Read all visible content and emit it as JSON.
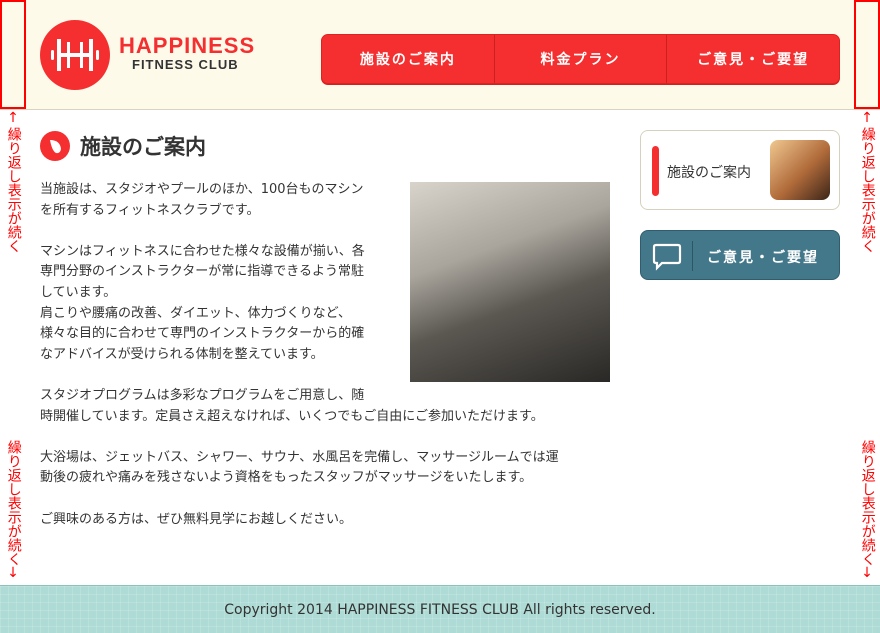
{
  "header": {
    "logo_line1": "HAPPINESS",
    "logo_line2": "FITNESS CLUB",
    "nav": [
      {
        "label": "施設のご案内"
      },
      {
        "label": "料金プラン"
      },
      {
        "label": "ご意見・ご要望"
      }
    ]
  },
  "annotation": "繰り返し表示が続く",
  "main": {
    "title": "施設のご案内",
    "lines": [
      "当施設は、スタジオやプールのほか、100台ものマシン",
      "を所有するフィットネスクラブです。",
      "",
      "マシンはフィットネスに合わせた様々な設備が揃い、各",
      "専門分野のインストラクターが常に指導できるよう常駐",
      "しています。",
      "肩こりや腰痛の改善、ダイエット、体力づくりなど、",
      "様々な目的に合わせて専門のインストラクターから的確",
      "なアドバイスが受けられる体制を整えています。",
      "",
      "スタジオプログラムは多彩なプログラムをご用意し、随",
      "時開催しています。定員さえ超えなければ、いくつでもご自由にご参加いただけます。",
      "",
      "大浴場は、ジェットバス、シャワー、サウナ、水風呂を完備し、マッサージルームでは運",
      "動後の疲れや痛みを残さないよう資格をもったスタッフがマッサージをいたします。",
      "",
      "ご興味のある方は、ぜひ無料見学にお越しください。"
    ]
  },
  "sidebar": {
    "facility_label": "施設のご案内",
    "feedback_label": "ご意見・ご要望"
  },
  "footer": {
    "copyright": "Copyright 2014 HAPPINESS FITNESS CLUB All rights reserved."
  }
}
